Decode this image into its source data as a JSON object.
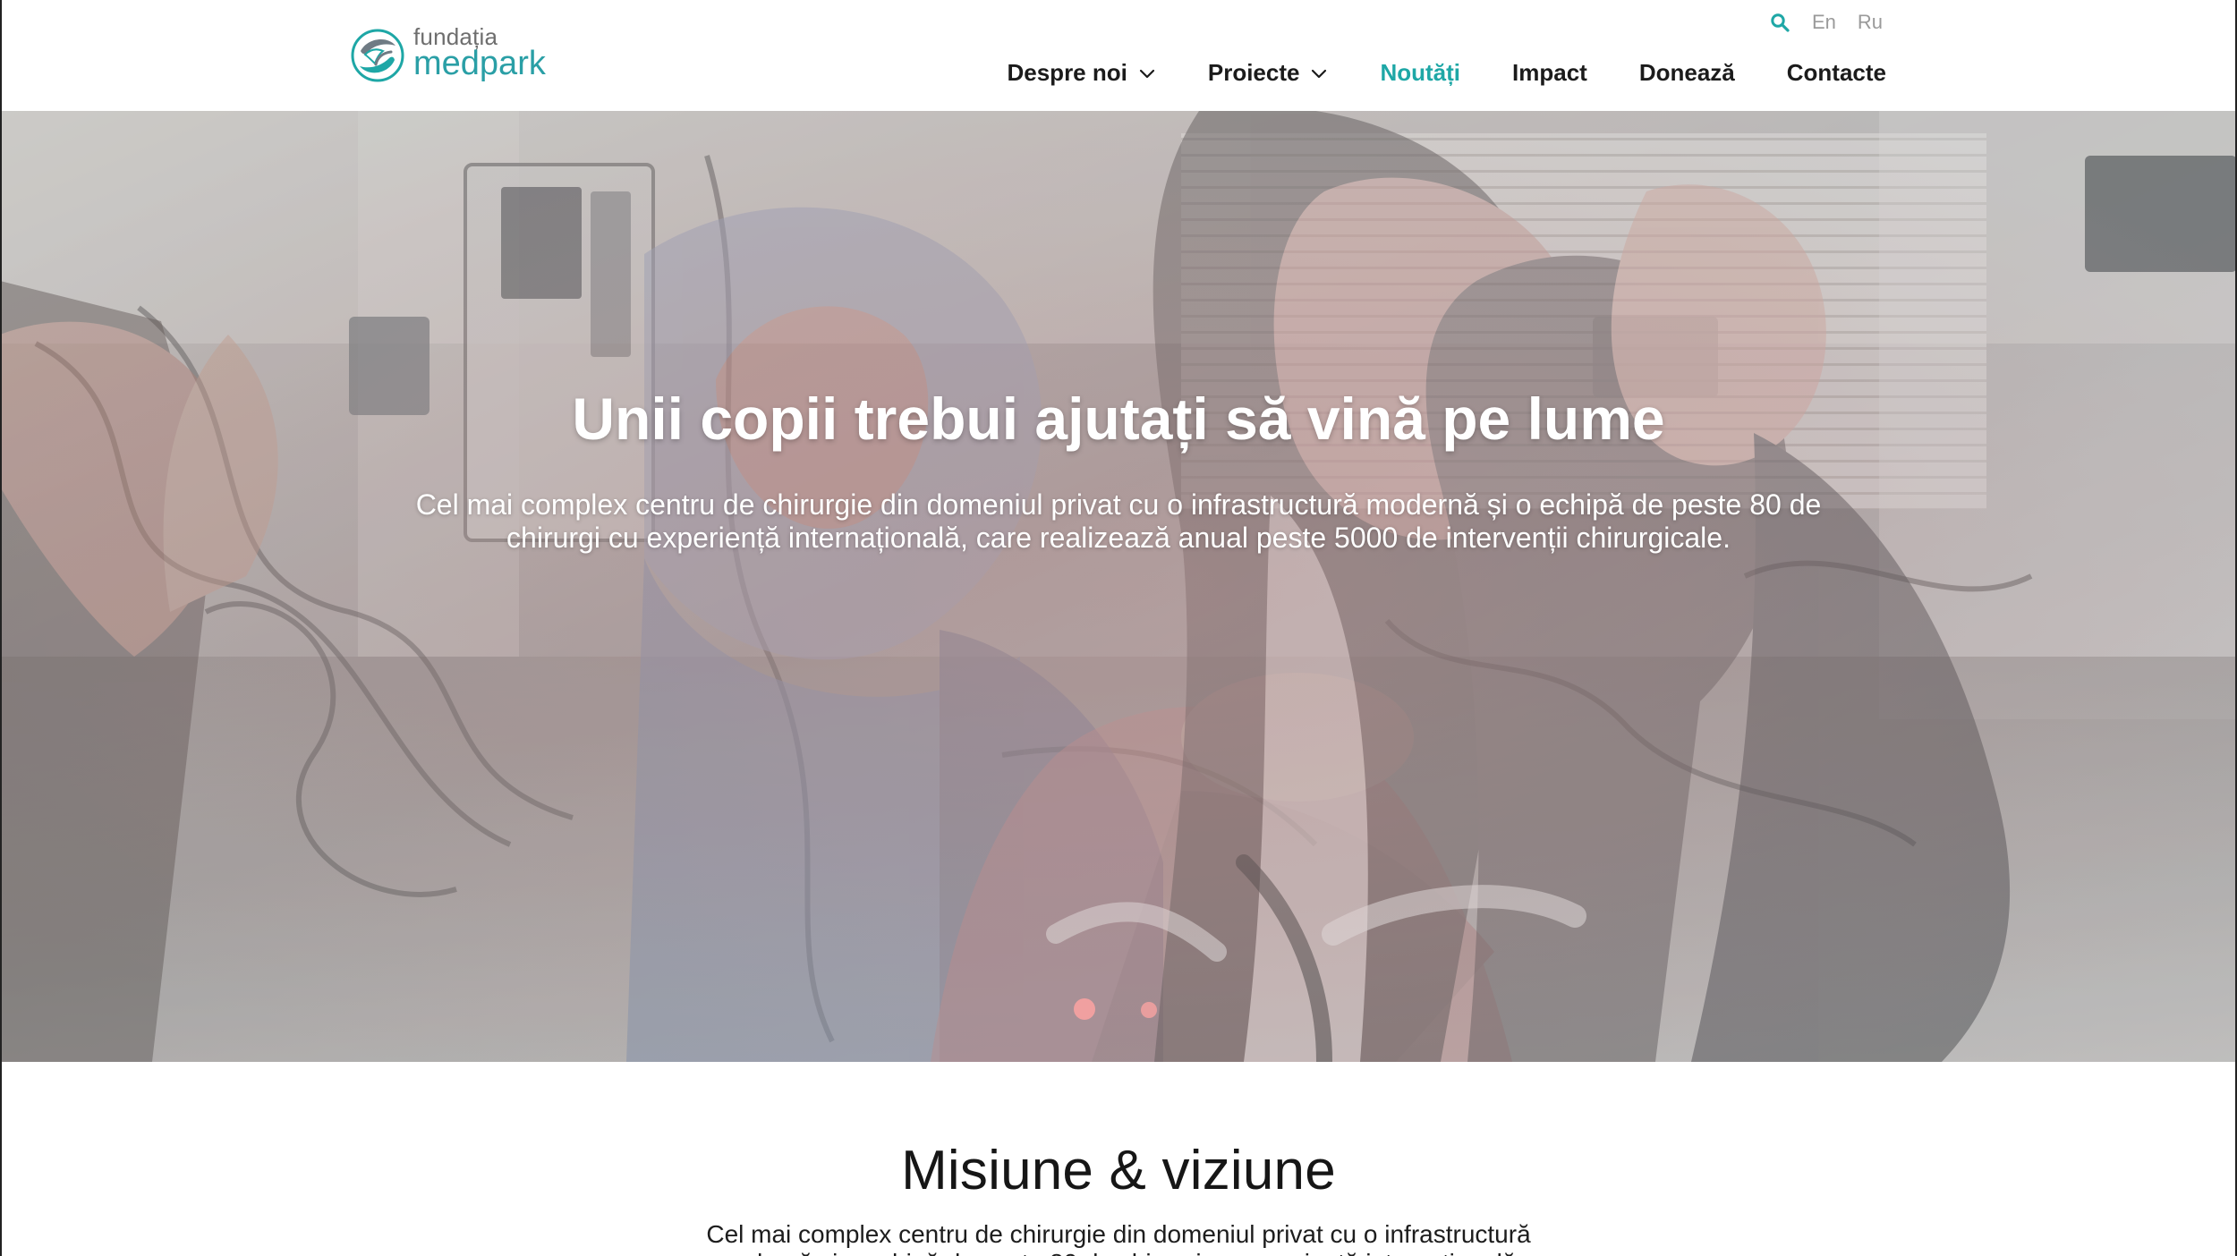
{
  "header": {
    "logo": {
      "top_text": "fundația",
      "brand_text": "medpark"
    },
    "utility": {
      "search_icon": "search-icon",
      "languages": [
        "En",
        "Ru"
      ]
    },
    "nav": [
      {
        "label": "Despre noi",
        "dropdown": true
      },
      {
        "label": "Proiecte",
        "dropdown": true
      },
      {
        "label": "Noutăți",
        "active": true
      },
      {
        "label": "Impact"
      },
      {
        "label": "Donează"
      },
      {
        "label": "Contacte"
      }
    ]
  },
  "hero": {
    "title": "Unii copii trebui ajutați să vină pe lume",
    "text": "Cel mai complex centru de chirurgie din domeniul privat cu o infrastructură modernă și o echipă de peste 80 de chirurgi cu experiență internațională, care realizează anual peste 5000 de intervenții chirurgicale.",
    "slides": 2,
    "active_slide": 1
  },
  "mission": {
    "title": "Misiune & viziune",
    "text": "Cel mai complex centru de chirurgie din domeniul privat cu o infrastructură modernă și o echipă de peste 80 de chirurgi cu experiență internațională, care"
  },
  "colors": {
    "accent": "#1ea7a6",
    "logo_text": "#2a9fa6",
    "nav_text": "#1b1b1b",
    "language_text": "#9a9a9a",
    "hero_dot": "#f0a0a0"
  }
}
